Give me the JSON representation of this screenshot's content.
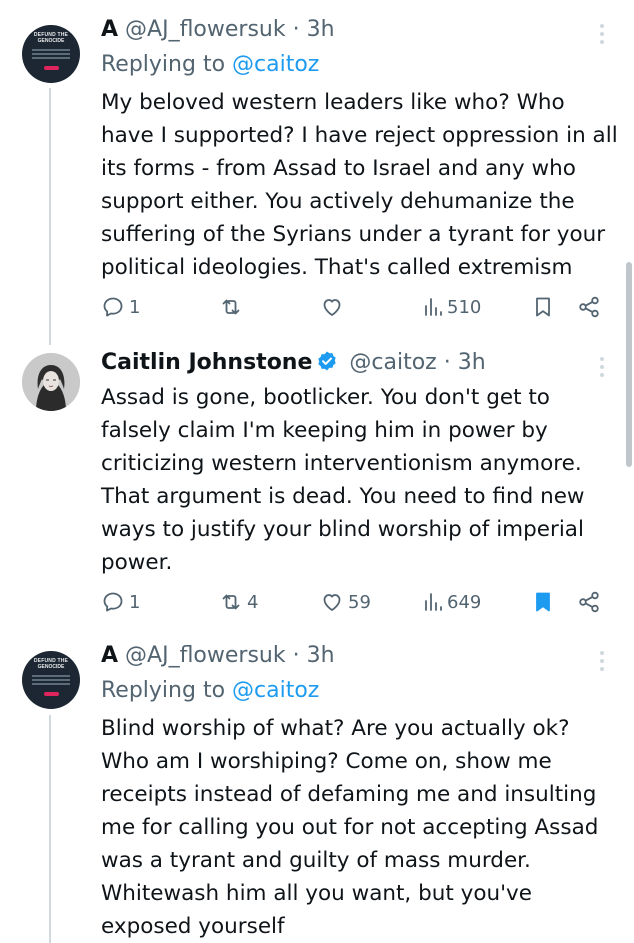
{
  "tweets": [
    {
      "name": "A",
      "handle": "@AJ_flowersuk",
      "separator": "·",
      "time": "3h",
      "replying_prefix": "Replying to",
      "replying_to": "@caitoz",
      "avatar_text": [
        "DEFUND THE",
        "GENOCIDE"
      ],
      "body": "My beloved western leaders like who? Who have I supported? I have reject oppression in all its forms - from Assad to Israel and any who support either. You actively dehumanize the suffering of the Syrians under a tyrant for your political ideologies. That's called extremism",
      "replies": "1",
      "reposts": "",
      "likes": "",
      "views": "510",
      "bookmarked": false
    },
    {
      "name": "Caitlin Johnstone",
      "handle": "@caitoz",
      "separator": "·",
      "time": "3h",
      "verified": true,
      "body": "Assad is gone, bootlicker. You don't get to falsely claim I'm keeping him in power by criticizing western interventionism anymore. That argument is dead. You need to find new ways to justify your blind worship of imperial power.",
      "replies": "1",
      "reposts": "4",
      "likes": "59",
      "views": "649",
      "bookmarked": true
    },
    {
      "name": "A",
      "handle": "@AJ_flowersuk",
      "separator": "·",
      "time": "3h",
      "replying_prefix": "Replying to",
      "replying_to": "@caitoz",
      "avatar_text": [
        "DEFUND THE",
        "GENOCIDE"
      ],
      "body": "Blind worship of what? Are you actually ok? Who am I worshiping? Come on, show me receipts instead of defaming me and insulting me for calling you out for not accepting Assad was a tyrant and guilty of mass murder. Whitewash him all you want, but you've exposed yourself"
    }
  ],
  "colors": {
    "text": "#0f1419",
    "secondary": "#536471",
    "link": "#1d9bf0",
    "verified": "#1d9bf0",
    "thread_line": "#cfd9de"
  },
  "icons": {
    "reply": "reply-icon",
    "repost": "repost-icon",
    "like": "heart-icon",
    "views": "views-icon",
    "bookmark": "bookmark-icon",
    "share": "share-icon",
    "more": "more-icon",
    "verified": "verified-badge-icon"
  }
}
